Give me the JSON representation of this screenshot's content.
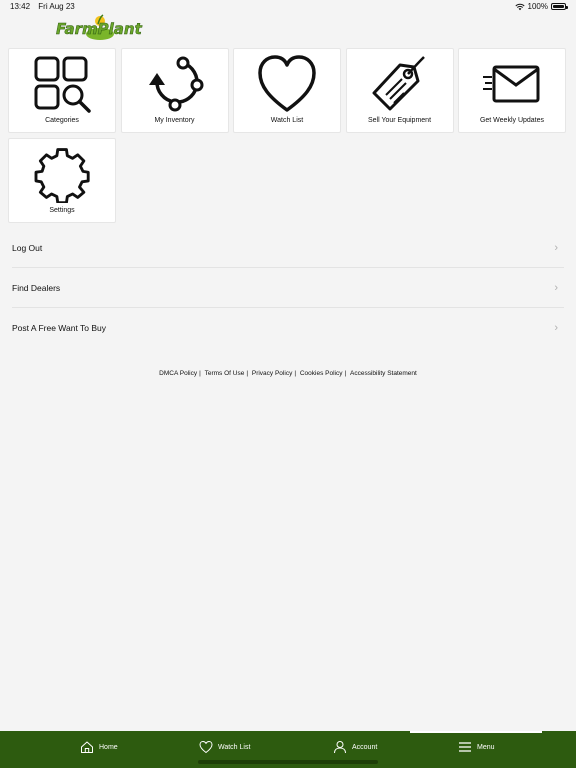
{
  "status": {
    "time": "13:42",
    "date": "Fri Aug 23",
    "battery": "100%"
  },
  "brand": {
    "logo_text": "FarmPlant",
    "accent_color": "#2d5b0f"
  },
  "tiles": [
    {
      "label": "Categories",
      "icon": "categories-icon"
    },
    {
      "label": "My Inventory",
      "icon": "inventory-icon"
    },
    {
      "label": "Watch List",
      "icon": "heart-icon"
    },
    {
      "label": "Sell Your Equipment",
      "icon": "price-tag-icon"
    },
    {
      "label": "Get Weekly Updates",
      "icon": "envelope-icon"
    },
    {
      "label": "Settings",
      "icon": "gear-icon"
    }
  ],
  "menu": [
    {
      "label": "Log Out"
    },
    {
      "label": "Find Dealers"
    },
    {
      "label": "Post A Free Want To Buy"
    }
  ],
  "footer_links": [
    "DMCA Policy",
    "Terms Of Use",
    "Privacy Policy",
    "Cookies Policy",
    "Accessibility Statement"
  ],
  "tabbar": {
    "home": "Home",
    "watch_list": "Watch List",
    "account": "Account",
    "menu": "Menu",
    "active": "Menu"
  }
}
